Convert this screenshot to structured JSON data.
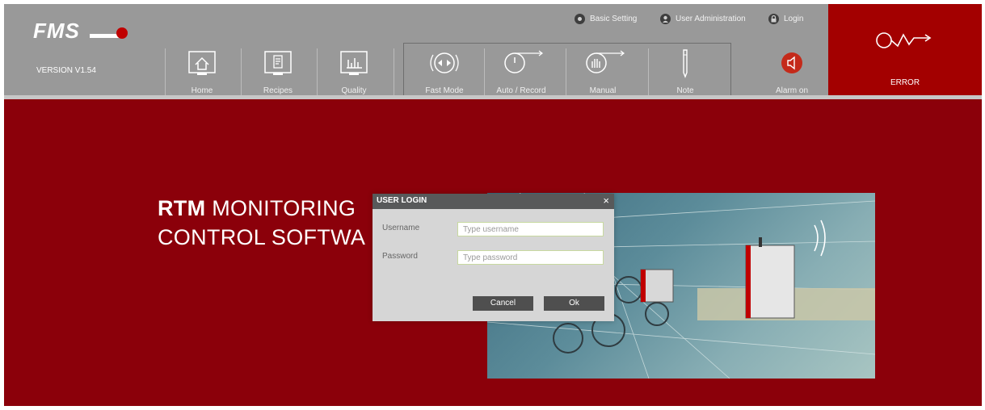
{
  "app": {
    "logo_text": "FMS",
    "version": "VERSION V1.54"
  },
  "top_links": {
    "basic_setting": "Basic Setting",
    "user_administration": "User Administration",
    "login": "Login"
  },
  "nav": {
    "home": "Home",
    "recipes": "Recipes",
    "quality": "Quality",
    "fast_mode": "Fast Mode",
    "auto_record": "Auto / Record",
    "manual": "Manual",
    "note": "Note",
    "alarm": "Alarm on"
  },
  "status": {
    "error": "ERROR"
  },
  "hero": {
    "title_bold": "RTM",
    "title_rest": " MONITORING",
    "title_line2": "CONTROL SOFTWA"
  },
  "dialog": {
    "title": "USER LOGIN",
    "close": "×",
    "username_label": "Username",
    "username_placeholder": "Type username",
    "username_value": "",
    "password_label": "Password",
    "password_placeholder": "Type password",
    "password_value": "",
    "cancel_label": "Cancel",
    "ok_label": "Ok"
  },
  "colors": {
    "header_bg": "#999999",
    "error_bg": "#a30000",
    "main_bg": "#8b000a",
    "dialog_bg": "#d6d6d6",
    "dialog_header": "#58595a",
    "button_bg": "#4f4f4f"
  }
}
